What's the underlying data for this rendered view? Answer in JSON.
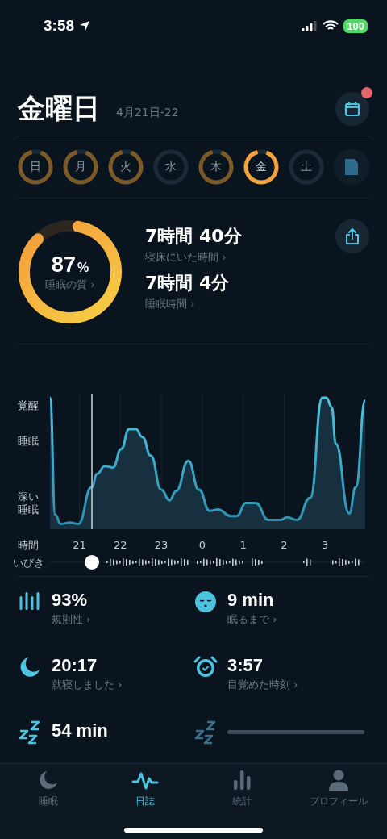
{
  "status_bar": {
    "time": "3:58",
    "battery": "100"
  },
  "header": {
    "title": "金曜日",
    "date": "4月21日-22",
    "calendar_badge": true
  },
  "week": [
    {
      "label": "日",
      "color": "#7c5a27",
      "selected": false
    },
    {
      "label": "月",
      "color": "#7c5a27",
      "selected": false
    },
    {
      "label": "火",
      "color": "#7c5a27",
      "selected": false
    },
    {
      "label": "水",
      "selected": false
    },
    {
      "label": "木",
      "color": "#7c5a27",
      "selected": false
    },
    {
      "label": "金",
      "color": "#f6a23a",
      "selected": true
    },
    {
      "label": "土",
      "selected": false
    }
  ],
  "summary": {
    "quality": {
      "value": "87",
      "unit": "%",
      "label": "睡眠の質 ›"
    },
    "metrics": [
      {
        "value": "7時間 40分",
        "label": "寝床にいた時間 ›"
      },
      {
        "value": "7時間 4分",
        "label": "睡眠時間 ›"
      }
    ]
  },
  "chart": {
    "y_labels": [
      "覚醒",
      "睡眠",
      "深い睡眠"
    ],
    "x_title": "時間",
    "x_labels": [
      "21",
      "22",
      "23",
      "0",
      "1",
      "2",
      "3"
    ],
    "snore_label": "いびき"
  },
  "stats": [
    {
      "kind": "regularity",
      "value": "93%",
      "label": "規則性 ›"
    },
    {
      "kind": "fall-asleep",
      "value": "9 min",
      "label": "眠るまで ›"
    },
    {
      "kind": "bedtime",
      "value": "20:17",
      "label": "就寝しました ›"
    },
    {
      "kind": "wake",
      "value": "3:57",
      "label": "目覚めた時刻 ›"
    },
    {
      "kind": "snooze",
      "value": "54 min"
    },
    {
      "kind": "loading"
    }
  ],
  "tabs": [
    {
      "kind": "sleep",
      "label": "睡眠",
      "selected": false
    },
    {
      "kind": "journal",
      "label": "日誌",
      "selected": true
    },
    {
      "kind": "stats",
      "label": "統計",
      "selected": false
    },
    {
      "kind": "profile",
      "label": "プロフィール",
      "selected": false
    }
  ]
}
